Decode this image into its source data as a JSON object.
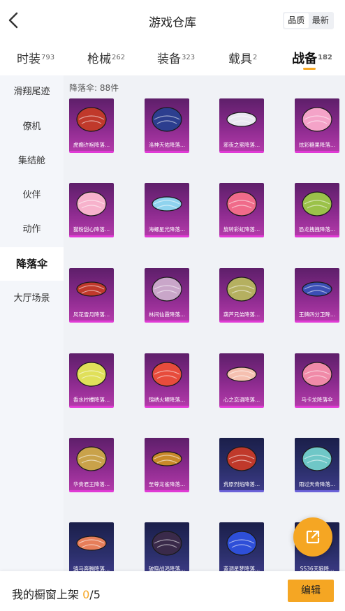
{
  "header": {
    "title": "游戏仓库",
    "sort_options": [
      "品质",
      "最新"
    ],
    "sort_active": "品质"
  },
  "tabs": [
    {
      "label": "时装",
      "count": "793"
    },
    {
      "label": "枪械",
      "count": "262"
    },
    {
      "label": "装备",
      "count": "323"
    },
    {
      "label": "载具",
      "count": "2"
    },
    {
      "label": "战备",
      "count": "182",
      "active": true
    }
  ],
  "sidebar": {
    "items": [
      "滑翔尾迹",
      "僚机",
      "集结舱",
      "伙伴",
      "动作",
      "降落伞",
      "大厅场景"
    ],
    "active": "降落伞"
  },
  "content": {
    "count_text": "降落伞: 88件",
    "items": [
      {
        "label": "虎癫许袍降落...",
        "style": "purple",
        "color": "#c0392b"
      },
      {
        "label": "洛神天佑降落...",
        "style": "purple",
        "color": "#2c3e8f"
      },
      {
        "label": "邪夜之冕降落...",
        "style": "purple",
        "color": "#e8e8f0"
      },
      {
        "label": "炫彩糖果降落...",
        "style": "purple",
        "color": "#f4a3c8"
      },
      {
        "label": "猫粉甜心降落...",
        "style": "purple",
        "color": "#f7b2cc"
      },
      {
        "label": "海螺星光降落...",
        "style": "purple",
        "color": "#8fd3ee"
      },
      {
        "label": "旋转彩虹降落...",
        "style": "purple",
        "color": "#f06b8a"
      },
      {
        "label": "恐龙拽拽降落...",
        "style": "purple",
        "color": "#9bc24a"
      },
      {
        "label": "风花雪月降落...",
        "style": "purple",
        "color": "#c0392b"
      },
      {
        "label": "林间仙霞降落...",
        "style": "purple",
        "color": "#c9a6c9"
      },
      {
        "label": "葫芦兄弟降落...",
        "style": "purple",
        "color": "#b5b060"
      },
      {
        "label": "王牌四分卫降...",
        "style": "purple",
        "color": "#3b4fb5"
      },
      {
        "label": "香水柠檬降落...",
        "style": "purple",
        "color": "#e0e05a"
      },
      {
        "label": "锦绣火鲤降落...",
        "style": "purple",
        "color": "#e74c3c"
      },
      {
        "label": "心之恋语降落...",
        "style": "purple",
        "color": "#f5c0b0"
      },
      {
        "label": "马卡龙降落伞",
        "style": "purple",
        "color": "#f08aa8"
      },
      {
        "label": "华贵君王降落...",
        "style": "purple",
        "color": "#c9a24a"
      },
      {
        "label": "至尊龙雀降落...",
        "style": "purple",
        "color": "#c98a2a"
      },
      {
        "label": "荒原烈焰降落...",
        "style": "blue",
        "color": "#c0392b"
      },
      {
        "label": "雨过天青降落...",
        "style": "blue",
        "color": "#6fc7c7"
      },
      {
        "label": "骁马奔腾降落...",
        "style": "blue",
        "color": "#e67e5a"
      },
      {
        "label": "破晓战鸿降落...",
        "style": "blue",
        "color": "#3a2a4a"
      },
      {
        "label": "蓝调星梦降落...",
        "style": "blue",
        "color": "#2e4fd8"
      },
      {
        "label": "SS36天狼降...",
        "style": "blue",
        "color": "#e0b050"
      }
    ]
  },
  "bottom": {
    "showcase_label": "我的橱窗上架",
    "current": "0",
    "separator_total": "/5",
    "edit_label": "编辑"
  },
  "colors": {
    "accent": "#f5a623",
    "purple_frame": "#e03ad5",
    "blue_frame": "#6b62d8"
  }
}
